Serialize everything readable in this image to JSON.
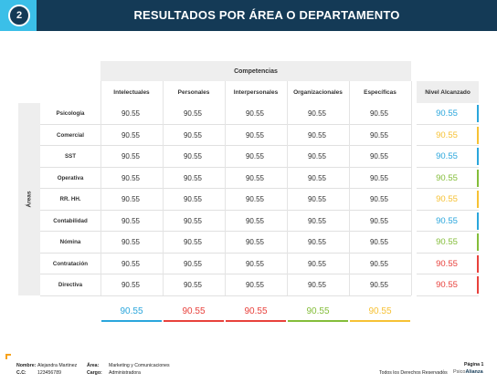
{
  "header": {
    "badge": "2",
    "title": "RESULTADOS POR ÁREA O DEPARTAMENTO"
  },
  "table": {
    "competencias_label": "Competencias",
    "columns": [
      "Intelectuales",
      "Personales",
      "Interpersonales",
      "Organizacionales",
      "Específicas"
    ],
    "nivel_label": "Nivel Alcanzado",
    "areas_label": "Áreas",
    "rows": [
      {
        "area": "Psicología",
        "values": [
          "90.55",
          "90.55",
          "90.55",
          "90.55",
          "90.55"
        ],
        "nivel": "90.55",
        "color": "#2aa6dc"
      },
      {
        "area": "Comercial",
        "values": [
          "90.55",
          "90.55",
          "90.55",
          "90.55",
          "90.55"
        ],
        "nivel": "90.55",
        "color": "#f6c134"
      },
      {
        "area": "SST",
        "values": [
          "90.55",
          "90.55",
          "90.55",
          "90.55",
          "90.55"
        ],
        "nivel": "90.55",
        "color": "#2aa6dc"
      },
      {
        "area": "Operativa",
        "values": [
          "90.55",
          "90.55",
          "90.55",
          "90.55",
          "90.55"
        ],
        "nivel": "90.55",
        "color": "#84bd3a"
      },
      {
        "area": "RR. HH.",
        "values": [
          "90.55",
          "90.55",
          "90.55",
          "90.55",
          "90.55"
        ],
        "nivel": "90.55",
        "color": "#f6c134"
      },
      {
        "area": "Contabilidad",
        "values": [
          "90.55",
          "90.55",
          "90.55",
          "90.55",
          "90.55"
        ],
        "nivel": "90.55",
        "color": "#2aa6dc"
      },
      {
        "area": "Nómina",
        "values": [
          "90.55",
          "90.55",
          "90.55",
          "90.55",
          "90.55"
        ],
        "nivel": "90.55",
        "color": "#84bd3a"
      },
      {
        "area": "Contratación",
        "values": [
          "90.55",
          "90.55",
          "90.55",
          "90.55",
          "90.55"
        ],
        "nivel": "90.55",
        "color": "#e8413c"
      },
      {
        "area": "Directiva",
        "values": [
          "90.55",
          "90.55",
          "90.55",
          "90.55",
          "90.55"
        ],
        "nivel": "90.55",
        "color": "#e8413c"
      }
    ],
    "averages": [
      {
        "value": "90.55",
        "color": "#2aa6dc"
      },
      {
        "value": "90.55",
        "color": "#e8413c"
      },
      {
        "value": "90.55",
        "color": "#e8413c"
      },
      {
        "value": "90.55",
        "color": "#84bd3a"
      },
      {
        "value": "90.55",
        "color": "#f6c134"
      }
    ]
  },
  "footer": {
    "nombre_label": "Nombre:",
    "nombre": "Alejandra Martinez",
    "cc_label": "C.C:",
    "cc": "123456789",
    "area_label": "Área:",
    "area": "Marketing y Comunicaciones",
    "cargo_label": "Cargo:",
    "cargo": "Administradora",
    "page": "Página 1",
    "rights": "Todos los Derechos Reservados",
    "logo_a": "Psico",
    "logo_b": "Alianza"
  },
  "colors": {
    "header_bg": "#143a56",
    "accent": "#3bbfe8",
    "footer_accent": "#f7a21b"
  }
}
